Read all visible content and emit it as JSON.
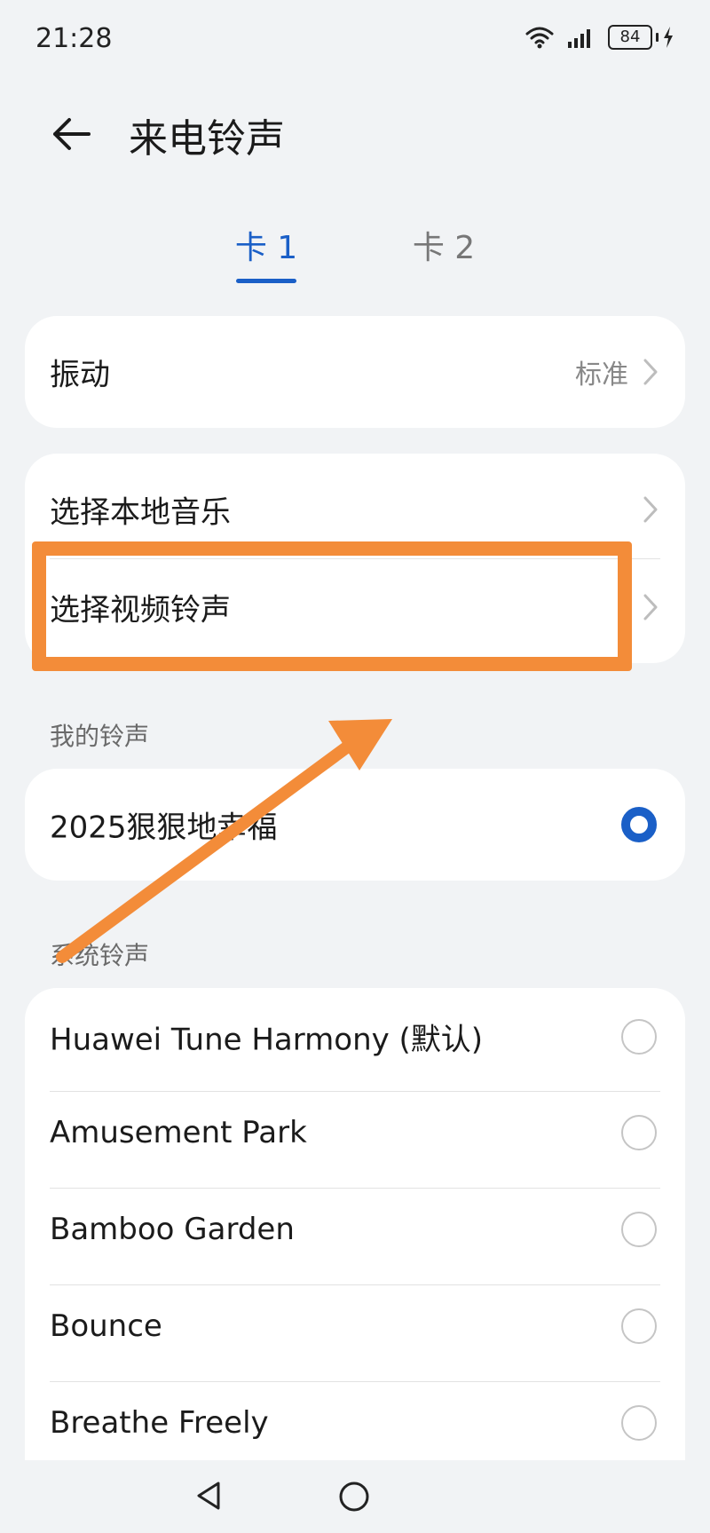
{
  "status": {
    "time": "21:28",
    "battery": "84"
  },
  "header": {
    "title": "来电铃声"
  },
  "tabs": [
    {
      "label": "卡 1"
    },
    {
      "label": "卡 2"
    }
  ],
  "vibration": {
    "label": "振动",
    "value": "标准"
  },
  "sources": [
    {
      "label": "选择本地音乐"
    },
    {
      "label": "选择视频铃声"
    }
  ],
  "my_ringtones": {
    "title": "我的铃声",
    "items": [
      {
        "label": "2025狠狠地幸福",
        "selected": true
      }
    ]
  },
  "system_ringtones": {
    "title": "系统铃声",
    "items": [
      {
        "label": "Huawei Tune Harmony (默认)",
        "selected": false
      },
      {
        "label": "Amusement Park",
        "selected": false
      },
      {
        "label": "Bamboo Garden",
        "selected": false
      },
      {
        "label": "Bounce",
        "selected": false
      },
      {
        "label": "Breathe Freely",
        "selected": false
      }
    ]
  },
  "colors": {
    "accent": "#1a5fc7",
    "annotation": "#f38c39"
  }
}
